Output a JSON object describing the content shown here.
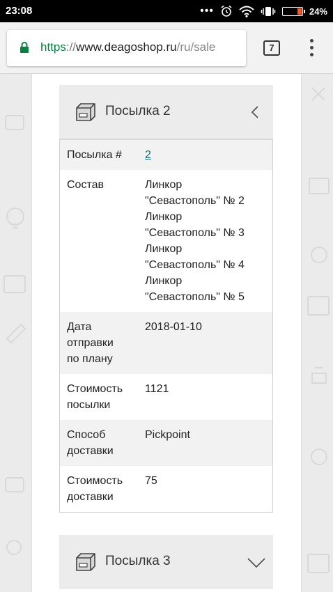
{
  "status_bar": {
    "time": "23:08",
    "dots": "•••",
    "battery_percent": "24%",
    "battery_level": 0.24,
    "battery_color": "#ff5722"
  },
  "browser": {
    "url": {
      "scheme": "https",
      "separator": "://",
      "host": "www.deagoshop.ru",
      "path": "/ru/sale"
    },
    "tab_count": "7",
    "secure_color": "#0b8043"
  },
  "parcels": {
    "parcel_2": {
      "title": "Посылка 2",
      "expanded": true,
      "rows": [
        {
          "label": "Посылка #",
          "value": "2",
          "is_link": true
        },
        {
          "label": "Состав",
          "value_lines": [
            "Линкор",
            "\"Севастополь\" № 2",
            "Линкор",
            "\"Севастополь\" № 3",
            "Линкор",
            "\"Севастополь\" № 4",
            "Линкор",
            "\"Севастополь\" № 5"
          ]
        },
        {
          "label_lines": [
            "Дата",
            "отправки",
            "по плану"
          ],
          "value": "2018-01-10"
        },
        {
          "label_lines": [
            "Стоимость",
            "посылки"
          ],
          "value": "1121"
        },
        {
          "label_lines": [
            "Способ",
            "доставки"
          ],
          "value": "Pickpoint"
        },
        {
          "label_lines": [
            "Стоимость",
            "доставки"
          ],
          "value": "75"
        }
      ]
    },
    "parcel_3": {
      "title": "Посылка 3",
      "expanded": false
    }
  },
  "icons": {
    "lock": "lock-icon",
    "alarm": "alarm-clock-icon",
    "wifi": "wifi-icon",
    "vibrate": "vibrate-icon",
    "battery": "battery-icon",
    "parcel": "package-box-icon",
    "collapse": "chevron-left-icon",
    "expand": "chevron-down-icon",
    "tabs": "tab-switcher-icon",
    "menu": "overflow-menu-icon"
  }
}
